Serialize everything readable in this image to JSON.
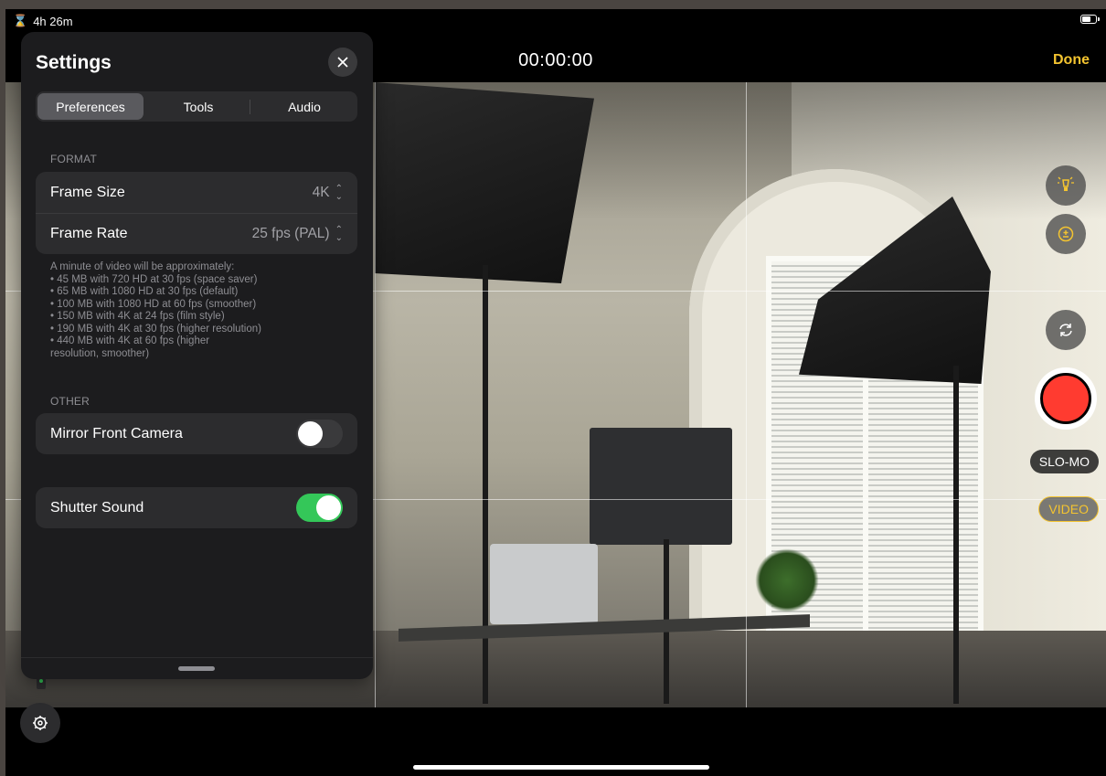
{
  "status_bar": {
    "time_remaining": "4h 26m",
    "battery": 0.7
  },
  "header": {
    "timer": "00:00:00",
    "done_label": "Done"
  },
  "settings": {
    "title": "Settings",
    "tabs": [
      "Preferences",
      "Tools",
      "Audio"
    ],
    "active_tab": "Preferences",
    "format": {
      "section_label": "FORMAT",
      "frame_size_label": "Frame Size",
      "frame_size_value": "4K",
      "frame_rate_label": "Frame Rate",
      "frame_rate_value": "25 fps (PAL)",
      "footnote": "A minute of video will be approximately:\n• 45 MB with 720 HD at 30 fps (space saver)\n• 65 MB with 1080 HD at 30 fps (default)\n• 100 MB with 1080 HD at 60 fps (smoother)\n• 150 MB with 4K at 24 fps (film style)\n• 190 MB with 4K at 30 fps (higher resolution)\n• 440 MB with 4K at 60 fps (higher\nresolution, smoother)"
    },
    "other": {
      "section_label": "OTHER",
      "mirror_label": "Mirror Front Camera",
      "mirror_on": false,
      "shutter_label": "Shutter Sound",
      "shutter_on": true
    }
  },
  "camera_controls": {
    "modes": [
      "SLO-MO",
      "VIDEO"
    ],
    "active_mode": "VIDEO",
    "icons": [
      "flash-light-icon",
      "exposure-icon",
      "switch-camera-icon",
      "record-button",
      "settings-gear-icon"
    ],
    "accent_color": "#f4c430",
    "record_color": "#ff3b30",
    "toggle_on_color": "#34c759"
  }
}
